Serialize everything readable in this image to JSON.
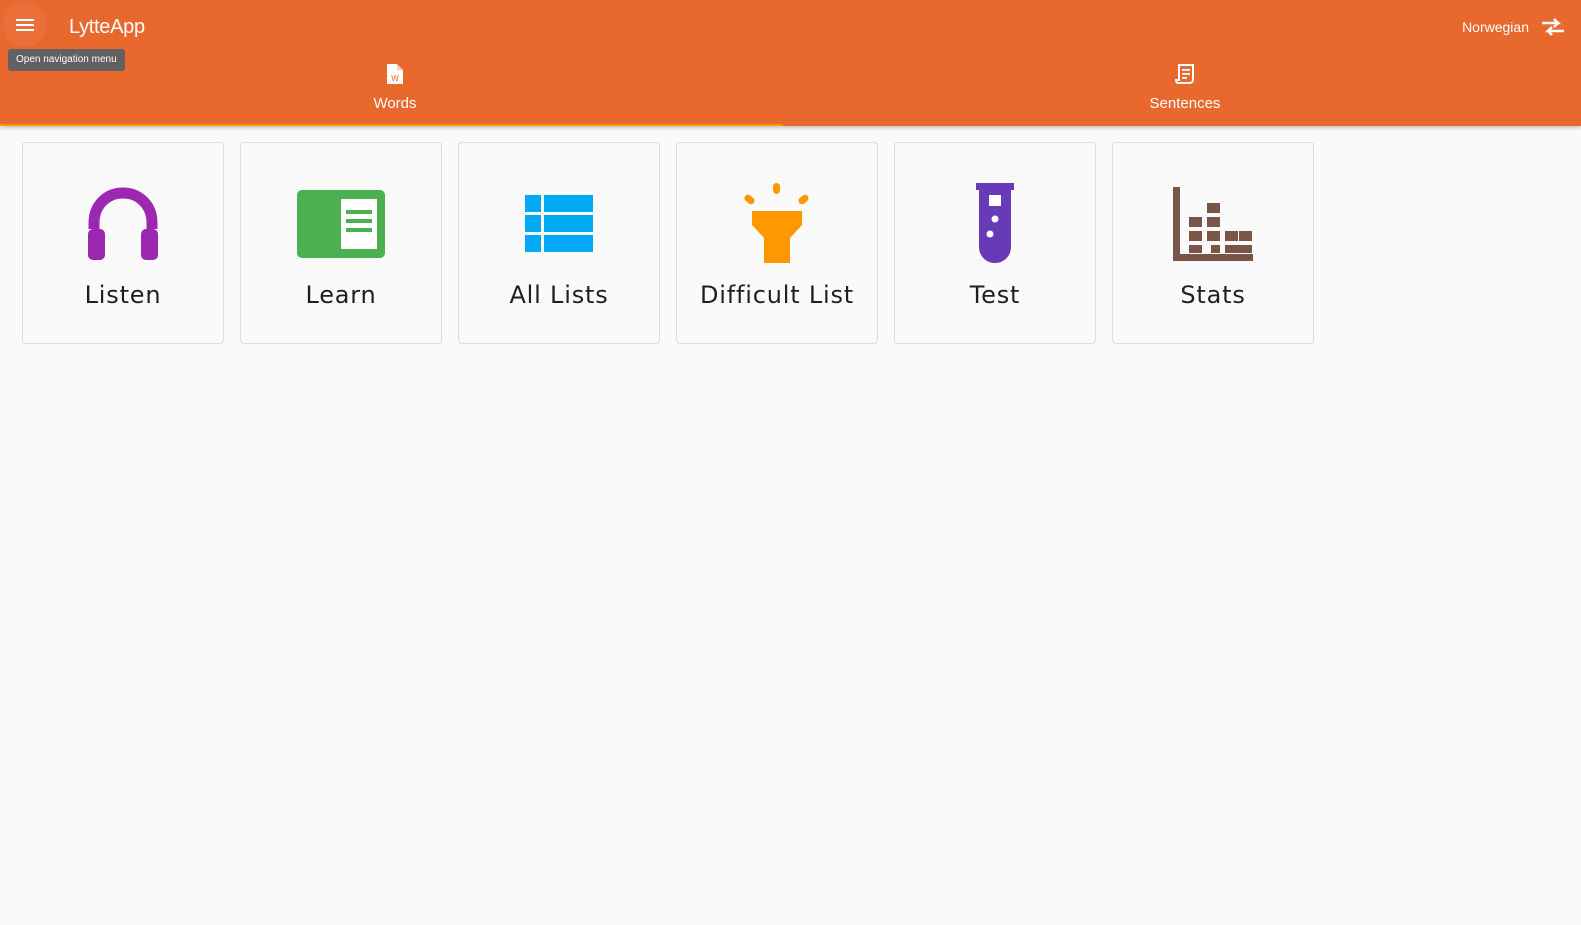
{
  "app": {
    "title": "LytteApp",
    "menu_tooltip": "Open navigation menu",
    "language": "Norwegian",
    "accent_color": "#e8682d",
    "indicator_color": "#ff9800"
  },
  "tabs": [
    {
      "label": "Words",
      "icon": "word-document-icon",
      "selected": true
    },
    {
      "label": "Sentences",
      "icon": "receipt-document-icon",
      "selected": false
    }
  ],
  "cards": [
    {
      "label": "Listen",
      "icon": "headphones-icon",
      "color": "#9c27b0"
    },
    {
      "label": "Learn",
      "icon": "book-reader-icon",
      "color": "#4caf50"
    },
    {
      "label": "All Lists",
      "icon": "list-icon",
      "color": "#03a9f4"
    },
    {
      "label": "Difficult List",
      "icon": "flashlight-icon",
      "color": "#ff9800"
    },
    {
      "label": "Test",
      "icon": "test-tube-icon",
      "color": "#673ab7"
    },
    {
      "label": "Stats",
      "icon": "bar-chart-icon",
      "color": "#795548"
    }
  ]
}
